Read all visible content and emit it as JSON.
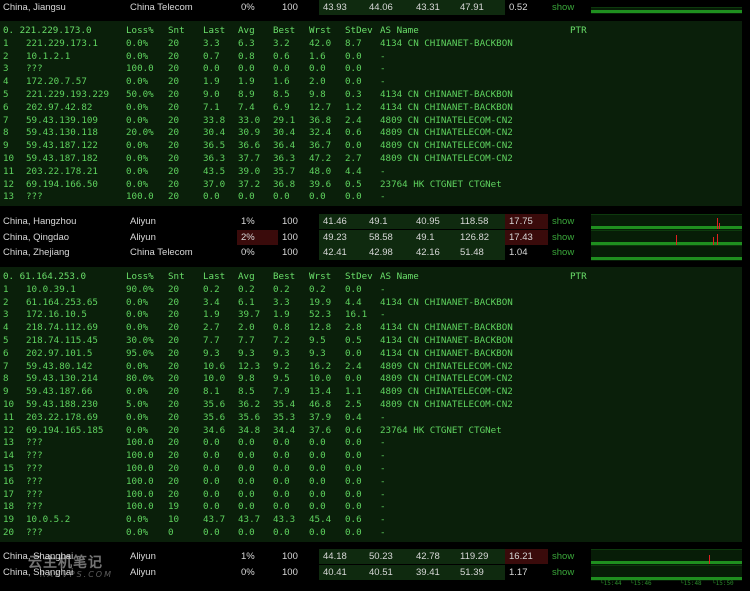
{
  "colors": {
    "green": "#5fd35f",
    "red": "#e02020",
    "show": "#3aa63a",
    "bg": "#000000"
  },
  "rows_top": [
    {
      "loc": "China, Jiangsu",
      "isp": "China Telecom",
      "loss": "0%",
      "snt": "100",
      "last": "43.93",
      "avg": "44.06",
      "best": "43.31",
      "wrst": "47.91",
      "stdev": "0.52",
      "show": "show"
    }
  ],
  "mtr1": {
    "header": {
      "host": "0. 221.229.173.0",
      "loss": "Loss%",
      "snt": "Snt",
      "last": "Last",
      "avg": "Avg",
      "best": "Best",
      "wrst": "Wrst",
      "stdev": "StDev",
      "as": "AS Name",
      "ptr": "PTR"
    },
    "hops": [
      {
        "h": "1",
        "ip": "221.229.173.1",
        "loss": "0.0%",
        "snt": "20",
        "last": "3.3",
        "avg": "6.3",
        "best": "3.2",
        "wrst": "42.0",
        "sd": "8.7",
        "as": "4134  CN  CHINANET-BACKBON"
      },
      {
        "h": "2",
        "ip": "10.1.2.1",
        "loss": "0.0%",
        "snt": "20",
        "last": "0.7",
        "avg": "0.8",
        "best": "0.6",
        "wrst": "1.6",
        "sd": "0.0",
        "as": "-"
      },
      {
        "h": "3",
        "ip": "???",
        "loss": "100.0",
        "snt": "20",
        "last": "0.0",
        "avg": "0.0",
        "best": "0.0",
        "wrst": "0.0",
        "sd": "0.0",
        "as": "-"
      },
      {
        "h": "4",
        "ip": "172.20.7.57",
        "loss": "0.0%",
        "snt": "20",
        "last": "1.9",
        "avg": "1.9",
        "best": "1.6",
        "wrst": "2.0",
        "sd": "0.0",
        "as": "-"
      },
      {
        "h": "5",
        "ip": "221.229.193.229",
        "loss": "50.0%",
        "snt": "20",
        "last": "9.0",
        "avg": "8.9",
        "best": "8.5",
        "wrst": "9.8",
        "sd": "0.3",
        "as": "4134  CN  CHINANET-BACKBON"
      },
      {
        "h": "6",
        "ip": "202.97.42.82",
        "loss": "0.0%",
        "snt": "20",
        "last": "7.1",
        "avg": "7.4",
        "best": "6.9",
        "wrst": "12.7",
        "sd": "1.2",
        "as": "4134  CN  CHINANET-BACKBON"
      },
      {
        "h": "7",
        "ip": "59.43.139.109",
        "loss": "0.0%",
        "snt": "20",
        "last": "33.8",
        "avg": "33.0",
        "best": "29.1",
        "wrst": "36.8",
        "sd": "2.4",
        "as": "4809  CN  CHINATELECOM-CN2"
      },
      {
        "h": "8",
        "ip": "59.43.130.118",
        "loss": "20.0%",
        "snt": "20",
        "last": "30.4",
        "avg": "30.9",
        "best": "30.4",
        "wrst": "32.4",
        "sd": "0.6",
        "as": "4809  CN  CHINATELECOM-CN2"
      },
      {
        "h": "9",
        "ip": "59.43.187.122",
        "loss": "0.0%",
        "snt": "20",
        "last": "36.5",
        "avg": "36.6",
        "best": "36.4",
        "wrst": "36.7",
        "sd": "0.0",
        "as": "4809  CN  CHINATELECOM-CN2"
      },
      {
        "h": "10",
        "ip": "59.43.187.182",
        "loss": "0.0%",
        "snt": "20",
        "last": "36.3",
        "avg": "37.7",
        "best": "36.3",
        "wrst": "47.2",
        "sd": "2.7",
        "as": "4809  CN  CHINATELECOM-CN2"
      },
      {
        "h": "11",
        "ip": "203.22.178.21",
        "loss": "0.0%",
        "snt": "20",
        "last": "43.5",
        "avg": "39.0",
        "best": "35.7",
        "wrst": "48.0",
        "sd": "4.4",
        "as": "-"
      },
      {
        "h": "12",
        "ip": "69.194.166.50",
        "loss": "0.0%",
        "snt": "20",
        "last": "37.0",
        "avg": "37.2",
        "best": "36.8",
        "wrst": "39.6",
        "sd": "0.5",
        "as": "23764 HK  CTGNET CTGNet"
      },
      {
        "h": "13",
        "ip": "???",
        "loss": "100.0",
        "snt": "20",
        "last": "0.0",
        "avg": "0.0",
        "best": "0.0",
        "wrst": "0.0",
        "sd": "0.0",
        "as": "-"
      }
    ]
  },
  "rows_mid": [
    {
      "loc": "China, Hangzhou",
      "isp": "Aliyun",
      "loss": "1%",
      "snt": "100",
      "last": "41.46",
      "avg": "49.1",
      "best": "40.95",
      "wrst": "118.58",
      "stdev": "17.75",
      "show": "show"
    },
    {
      "loc": "China, Qingdao",
      "isp": "Aliyun",
      "loss": "2%",
      "snt": "100",
      "last": "49.23",
      "avg": "58.58",
      "best": "49.1",
      "wrst": "126.82",
      "stdev": "17.43",
      "show": "show"
    },
    {
      "loc": "China, Zhejiang",
      "isp": "China Telecom",
      "loss": "0%",
      "snt": "100",
      "last": "42.41",
      "avg": "42.98",
      "best": "42.16",
      "wrst": "51.48",
      "stdev": "1.04",
      "show": "show"
    }
  ],
  "mtr2": {
    "header": {
      "host": "0. 61.164.253.0",
      "loss": "Loss%",
      "snt": "Snt",
      "last": "Last",
      "avg": "Avg",
      "best": "Best",
      "wrst": "Wrst",
      "stdev": "StDev",
      "as": "AS Name",
      "ptr": "PTR"
    },
    "hops": [
      {
        "h": "1",
        "ip": "10.0.39.1",
        "loss": "90.0%",
        "snt": "20",
        "last": "0.2",
        "avg": "0.2",
        "best": "0.2",
        "wrst": "0.2",
        "sd": "0.0",
        "as": "-"
      },
      {
        "h": "2",
        "ip": "61.164.253.65",
        "loss": "0.0%",
        "snt": "20",
        "last": "3.4",
        "avg": "6.1",
        "best": "3.3",
        "wrst": "19.9",
        "sd": "4.4",
        "as": "4134  CN  CHINANET-BACKBON"
      },
      {
        "h": "3",
        "ip": "172.16.10.5",
        "loss": "0.0%",
        "snt": "20",
        "last": "1.9",
        "avg": "39.7",
        "best": "1.9",
        "wrst": "52.3",
        "sd": "16.1",
        "as": "-"
      },
      {
        "h": "4",
        "ip": "218.74.112.69",
        "loss": "0.0%",
        "snt": "20",
        "last": "2.7",
        "avg": "2.0",
        "best": "0.8",
        "wrst": "12.8",
        "sd": "2.8",
        "as": "4134  CN  CHINANET-BACKBON"
      },
      {
        "h": "5",
        "ip": "218.74.115.45",
        "loss": "30.0%",
        "snt": "20",
        "last": "7.7",
        "avg": "7.7",
        "best": "7.2",
        "wrst": "9.5",
        "sd": "0.5",
        "as": "4134  CN  CHINANET-BACKBON"
      },
      {
        "h": "6",
        "ip": "202.97.101.5",
        "loss": "95.0%",
        "snt": "20",
        "last": "9.3",
        "avg": "9.3",
        "best": "9.3",
        "wrst": "9.3",
        "sd": "0.0",
        "as": "4134  CN  CHINANET-BACKBON"
      },
      {
        "h": "7",
        "ip": "59.43.80.142",
        "loss": "0.0%",
        "snt": "20",
        "last": "10.6",
        "avg": "12.3",
        "best": "9.2",
        "wrst": "16.2",
        "sd": "2.4",
        "as": "4809  CN  CHINATELECOM-CN2"
      },
      {
        "h": "8",
        "ip": "59.43.130.214",
        "loss": "80.0%",
        "snt": "20",
        "last": "10.0",
        "avg": "9.8",
        "best": "9.5",
        "wrst": "10.0",
        "sd": "0.0",
        "as": "4809  CN  CHINATELECOM-CN2"
      },
      {
        "h": "9",
        "ip": "59.43.187.66",
        "loss": "0.0%",
        "snt": "20",
        "last": "8.1",
        "avg": "8.5",
        "best": "7.9",
        "wrst": "13.4",
        "sd": "1.1",
        "as": "4809  CN  CHINATELECOM-CN2"
      },
      {
        "h": "10",
        "ip": "59.43.188.230",
        "loss": "5.0%",
        "snt": "20",
        "last": "35.6",
        "avg": "36.2",
        "best": "35.4",
        "wrst": "46.8",
        "sd": "2.5",
        "as": "4809  CN  CHINATELECOM-CN2"
      },
      {
        "h": "11",
        "ip": "203.22.178.69",
        "loss": "0.0%",
        "snt": "20",
        "last": "35.6",
        "avg": "35.6",
        "best": "35.3",
        "wrst": "37.9",
        "sd": "0.4",
        "as": "-"
      },
      {
        "h": "12",
        "ip": "69.194.165.185",
        "loss": "0.0%",
        "snt": "20",
        "last": "34.6",
        "avg": "34.8",
        "best": "34.4",
        "wrst": "37.6",
        "sd": "0.6",
        "as": "23764 HK  CTGNET CTGNet"
      },
      {
        "h": "13",
        "ip": "???",
        "loss": "100.0",
        "snt": "20",
        "last": "0.0",
        "avg": "0.0",
        "best": "0.0",
        "wrst": "0.0",
        "sd": "0.0",
        "as": "-"
      },
      {
        "h": "14",
        "ip": "???",
        "loss": "100.0",
        "snt": "20",
        "last": "0.0",
        "avg": "0.0",
        "best": "0.0",
        "wrst": "0.0",
        "sd": "0.0",
        "as": "-"
      },
      {
        "h": "15",
        "ip": "???",
        "loss": "100.0",
        "snt": "20",
        "last": "0.0",
        "avg": "0.0",
        "best": "0.0",
        "wrst": "0.0",
        "sd": "0.0",
        "as": "-"
      },
      {
        "h": "16",
        "ip": "???",
        "loss": "100.0",
        "snt": "20",
        "last": "0.0",
        "avg": "0.0",
        "best": "0.0",
        "wrst": "0.0",
        "sd": "0.0",
        "as": "-"
      },
      {
        "h": "17",
        "ip": "???",
        "loss": "100.0",
        "snt": "20",
        "last": "0.0",
        "avg": "0.0",
        "best": "0.0",
        "wrst": "0.0",
        "sd": "0.0",
        "as": "-"
      },
      {
        "h": "18",
        "ip": "???",
        "loss": "100.0",
        "snt": "19",
        "last": "0.0",
        "avg": "0.0",
        "best": "0.0",
        "wrst": "0.0",
        "sd": "0.0",
        "as": "-"
      },
      {
        "h": "19",
        "ip": "10.0.5.2",
        "loss": "0.0%",
        "snt": "10",
        "last": "43.7",
        "avg": "43.7",
        "best": "43.3",
        "wrst": "45.4",
        "sd": "0.6",
        "as": "-"
      },
      {
        "h": "20",
        "ip": "???",
        "loss": "0.0%",
        "snt": "0",
        "last": "0.0",
        "avg": "0.0",
        "best": "0.0",
        "wrst": "0.0",
        "sd": "0.0",
        "as": "-"
      }
    ]
  },
  "rows_bot": [
    {
      "loc": "China, Shanghai",
      "isp": "Aliyun",
      "loss": "1%",
      "snt": "100",
      "last": "44.18",
      "avg": "50.23",
      "best": "42.78",
      "wrst": "119.29",
      "stdev": "16.21",
      "show": "show"
    },
    {
      "loc": "China, Shanghai",
      "isp": "Aliyun",
      "loss": "0%",
      "snt": "100",
      "last": "40.41",
      "avg": "40.51",
      "best": "39.41",
      "wrst": "51.39",
      "stdev": "1.17",
      "show": "show"
    }
  ],
  "time_labels": [
    "└15:44",
    "└15:46",
    "└15:48",
    "└15:50"
  ],
  "watermark": {
    "line1": "云主机笔记",
    "line2": "RAKVPS.COM"
  }
}
